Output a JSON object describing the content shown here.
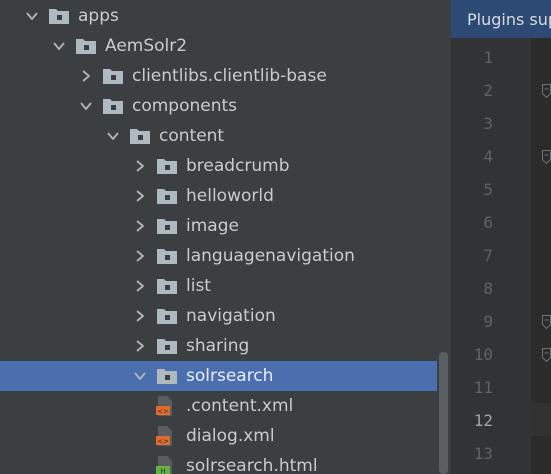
{
  "tree": {
    "rows": [
      {
        "label": "apps",
        "kind": "folder",
        "state": "expanded",
        "depth": 0
      },
      {
        "label": "AemSolr2",
        "kind": "folder",
        "state": "expanded",
        "depth": 1
      },
      {
        "label": "clientlibs.clientlib-base",
        "kind": "folder",
        "state": "collapsed",
        "depth": 2
      },
      {
        "label": "components",
        "kind": "folder",
        "state": "expanded",
        "depth": 2
      },
      {
        "label": "content",
        "kind": "folder",
        "state": "expanded",
        "depth": 3
      },
      {
        "label": "breadcrumb",
        "kind": "folder",
        "state": "collapsed",
        "depth": 4
      },
      {
        "label": "helloworld",
        "kind": "folder",
        "state": "collapsed",
        "depth": 4
      },
      {
        "label": "image",
        "kind": "folder",
        "state": "collapsed",
        "depth": 4
      },
      {
        "label": "languagenavigation",
        "kind": "folder",
        "state": "collapsed",
        "depth": 4
      },
      {
        "label": "list",
        "kind": "folder",
        "state": "collapsed",
        "depth": 4
      },
      {
        "label": "navigation",
        "kind": "folder",
        "state": "collapsed",
        "depth": 4
      },
      {
        "label": "sharing",
        "kind": "folder",
        "state": "collapsed",
        "depth": 4
      },
      {
        "label": "solrsearch",
        "kind": "folder",
        "state": "expanded",
        "depth": 4,
        "selected": true
      },
      {
        "label": ".content.xml",
        "kind": "xml",
        "depth": 5
      },
      {
        "label": "dialog.xml",
        "kind": "xml",
        "depth": 5
      },
      {
        "label": "solrsearch.html",
        "kind": "html",
        "depth": 5
      }
    ]
  },
  "editor": {
    "banner": "Plugins supported",
    "line_numbers": [
      "1",
      "2",
      "3",
      "4",
      "5",
      "6",
      "7",
      "8",
      "9",
      "10",
      "11",
      "12",
      "13"
    ],
    "current_line": "12",
    "fold_marker_lines": [
      "2",
      "4",
      "9",
      "10"
    ]
  },
  "colors": {
    "panel_bg": "#3c3f41",
    "selection": "#4b6eaf",
    "folder_icon": "#aeb9c0",
    "xml_icon": "#e06c2c",
    "html_icon": "#62b543"
  },
  "icons": {
    "expanded": "chevron-down-icon",
    "collapsed": "chevron-right-icon",
    "folder": "folder-icon",
    "xml": "xml-file-icon",
    "html": "html-file-icon"
  }
}
